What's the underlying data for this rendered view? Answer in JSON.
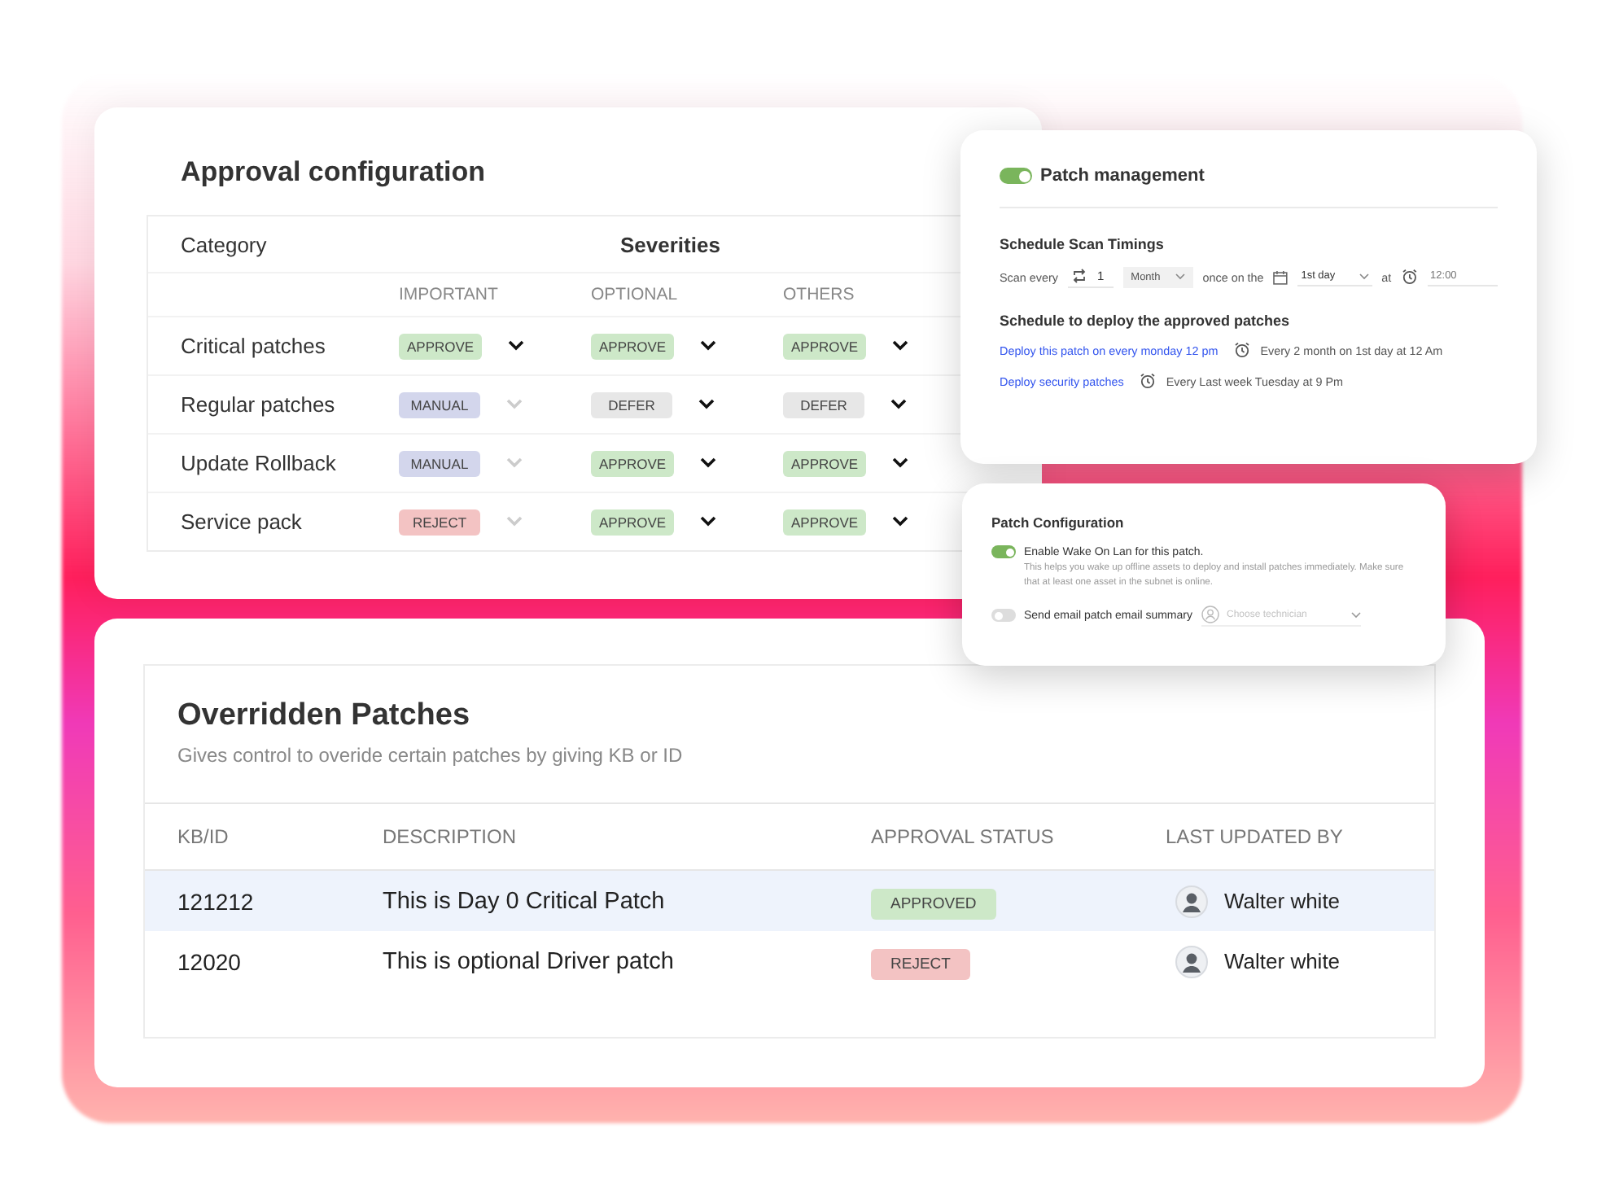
{
  "approval_configuration": {
    "title": "Approval configuration",
    "category_heading": "Category",
    "severities_heading": "Severities",
    "severities": [
      "IMPORTANT",
      "OPTIONAL",
      "OTHERS"
    ],
    "rows": [
      {
        "category": "Critical patches",
        "cells": [
          {
            "value": "APPROVE",
            "kind": "approve",
            "disabled": false
          },
          {
            "value": "APPROVE",
            "kind": "approve",
            "disabled": false
          },
          {
            "value": "APPROVE",
            "kind": "approve",
            "disabled": false
          }
        ]
      },
      {
        "category": "Regular patches",
        "cells": [
          {
            "value": "MANUAL",
            "kind": "manual",
            "disabled": true
          },
          {
            "value": "DEFER",
            "kind": "defer",
            "disabled": false
          },
          {
            "value": "DEFER",
            "kind": "defer",
            "disabled": false
          }
        ]
      },
      {
        "category": "Update Rollback",
        "cells": [
          {
            "value": "MANUAL",
            "kind": "manual",
            "disabled": true
          },
          {
            "value": "APPROVE",
            "kind": "approve",
            "disabled": false
          },
          {
            "value": "APPROVE",
            "kind": "approve",
            "disabled": false
          }
        ]
      },
      {
        "category": "Service pack",
        "cells": [
          {
            "value": "REJECT",
            "kind": "reject",
            "disabled": true
          },
          {
            "value": "APPROVE",
            "kind": "approve",
            "disabled": false
          },
          {
            "value": "APPROVE",
            "kind": "approve",
            "disabled": false
          }
        ]
      }
    ]
  },
  "patch_management": {
    "toggle": {
      "label": "Patch management",
      "on": true
    },
    "scan": {
      "title": "Schedule Scan Timings",
      "label": "Scan every",
      "count": "1",
      "period": "Month",
      "once_label": "once on the",
      "day": "1st day",
      "at_label": "at",
      "time": "12:00"
    },
    "deploy": {
      "title": "Schedule to deploy the approved patches",
      "items": [
        {
          "link": "Deploy this patch on every monday 12 pm",
          "schedule": "Every 2 month on 1st day at 12 Am"
        },
        {
          "link": "Deploy security patches",
          "schedule": "Every Last week Tuesday at 9 Pm"
        }
      ]
    }
  },
  "patch_configuration": {
    "title": "Patch Configuration",
    "options": [
      {
        "label": "Enable Wake On Lan for this patch.",
        "on": true,
        "description": "This helps you wake up offline assets to deploy and install patches immediately. Make sure that at least one asset in the subnet is online."
      },
      {
        "label": "Send email patch email summary",
        "on": false
      }
    ],
    "technician": {
      "placeholder": "Choose technician"
    }
  },
  "overridden_patches": {
    "title": "Overridden Patches",
    "subtitle": "Gives control to overide certain patches by giving KB or ID",
    "columns": [
      "KB/ID",
      "DESCRIPTION",
      "APPROVAL STATUS",
      "LAST UPDATED BY"
    ],
    "rows": [
      {
        "id": "121212",
        "description": "This is Day 0 Critical Patch",
        "status": {
          "value": "APPROVED",
          "kind": "approve"
        },
        "updated_by": "Walter white",
        "selected": true
      },
      {
        "id": "12020",
        "description": "This is optional Driver patch",
        "status": {
          "value": "REJECT",
          "kind": "reject"
        },
        "updated_by": "Walter white",
        "selected": false
      }
    ]
  }
}
